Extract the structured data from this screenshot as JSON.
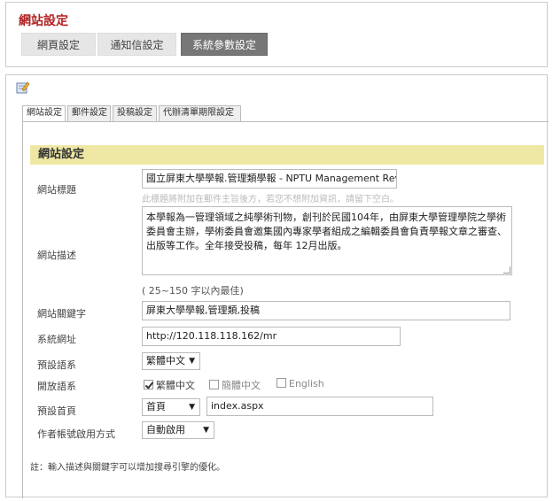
{
  "page": {
    "title": "網站設定",
    "top_tabs": [
      "網頁設定",
      "通知信設定",
      "系統參數設定"
    ],
    "active_top_tab": 2
  },
  "sub_tabs": [
    "網站設定",
    "郵件設定",
    "投稿設定",
    "代辦清單期限設定"
  ],
  "section_title": "網站設定",
  "form": {
    "site_title_label": "網站標題",
    "site_title_value": "國立屏東大學學報.管理類學報 - NPTU Management Revie",
    "site_title_hint": "此標題將附加在郵件主旨後方，若您不想附加資訊，請留下空白。",
    "site_desc_label": "網站描述",
    "site_desc_value": "本學報為一管理領域之純學術刊物，創刊於民國104年，由屏東大學管理學院之學術委員會主辦，學術委員會邀集國內專家學者組成之編輯委員會負責學報文章之審查、出版等工作。全年接受投稿，每年 12月出版。",
    "site_desc_hint": "( 25~150 字以內最佳)",
    "keywords_label": "網站關鍵字",
    "keywords_value": "屏東大學學報,管理類,投稿",
    "system_url_label": "系統網址",
    "system_url_value": "http://120.118.118.162/mr",
    "default_lang_label": "預設語系",
    "default_lang_value": "繁體中文",
    "open_lang_label": "開放語系",
    "open_langs": [
      {
        "label": "繁體中文",
        "checked": true
      },
      {
        "label": "簡體中文",
        "checked": false
      },
      {
        "label": "English",
        "checked": false
      }
    ],
    "default_home_label": "預設首頁",
    "default_home_value": "首頁",
    "default_home_file": "index.aspx",
    "author_account_label": "作者帳號啟用方式",
    "author_account_value": "自動啟用"
  },
  "footnote": "註：輸入描述與關鍵字可以增加搜尋引擎的優化。",
  "colors": {
    "title_red": "#b22222",
    "section_header_bg": "#efe8a4",
    "active_tab_bg": "#777777"
  },
  "icons": {
    "edit": "pencil-notepad-icon",
    "dropdown": "triangle-down-icon"
  }
}
